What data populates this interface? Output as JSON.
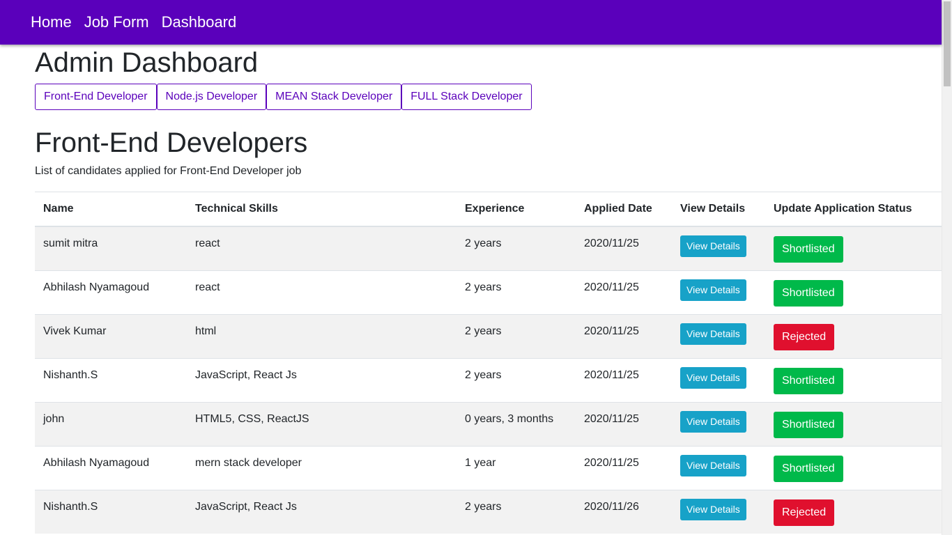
{
  "nav": {
    "items": [
      "Home",
      "Job Form",
      "Dashboard"
    ]
  },
  "page": {
    "title": "Admin Dashboard"
  },
  "filters": [
    "Front-End Developer",
    "Node.js Developer",
    "MEAN Stack Developer",
    "FULL Stack Developer"
  ],
  "section": {
    "title": "Front-End Developers",
    "subtitle": "List of candidates applied for Front-End Developer job"
  },
  "table": {
    "headers": [
      "Name",
      "Technical Skills",
      "Experience",
      "Applied Date",
      "View Details",
      "Update Application Status"
    ],
    "view_details_label": "View Details",
    "rows": [
      {
        "name": "sumit mitra",
        "skills": "react",
        "experience": "2 years",
        "date": "2020/11/25",
        "status": "Shortlisted"
      },
      {
        "name": "Abhilash Nyamagoud",
        "skills": "react",
        "experience": "2 years",
        "date": "2020/11/25",
        "status": "Shortlisted"
      },
      {
        "name": "Vivek Kumar",
        "skills": "html",
        "experience": "2 years",
        "date": "2020/11/25",
        "status": "Rejected"
      },
      {
        "name": "Nishanth.S",
        "skills": "JavaScript, React Js",
        "experience": "2 years",
        "date": "2020/11/25",
        "status": "Shortlisted"
      },
      {
        "name": "john",
        "skills": "HTML5, CSS, ReactJS",
        "experience": "0 years, 3 months",
        "date": "2020/11/25",
        "status": "Shortlisted"
      },
      {
        "name": "Abhilash Nyamagoud",
        "skills": "mern stack developer",
        "experience": "1 year",
        "date": "2020/11/25",
        "status": "Shortlisted"
      },
      {
        "name": "Nishanth.S",
        "skills": "JavaScript, React Js",
        "experience": "2 years",
        "date": "2020/11/26",
        "status": "Rejected"
      }
    ]
  },
  "colors": {
    "brand": "#5a00bb",
    "info": "#17a2c8",
    "shortlisted": "#00b94a",
    "rejected": "#e0102e"
  }
}
